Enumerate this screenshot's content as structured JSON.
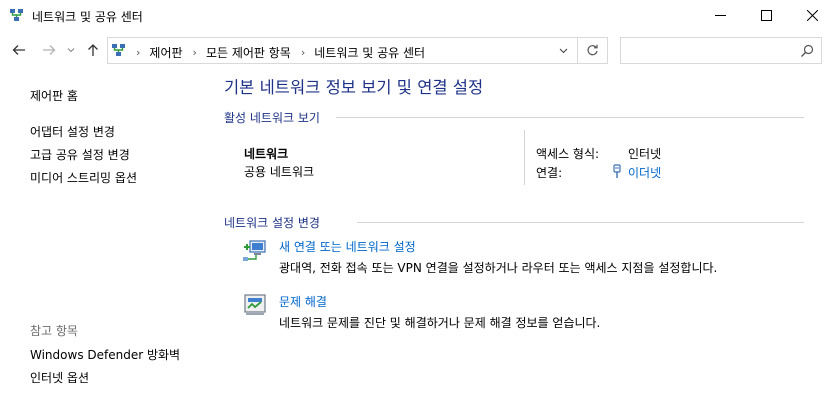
{
  "window": {
    "title": "네트워크 및 공유 센터"
  },
  "address": {
    "breadcrumbs": [
      "제어판",
      "모든 제어판 항목",
      "네트워크 및 공유 센터"
    ],
    "search_placeholder": ""
  },
  "left_pane": {
    "control_panel_home": "제어판 홈",
    "links": [
      "어댑터 설정 변경",
      "고급 공유 설정 변경",
      "미디어 스트리밍 옵션"
    ],
    "see_also_heading": "참고 항목",
    "see_also": [
      "Windows Defender 방화벽",
      "인터넷 옵션"
    ]
  },
  "main": {
    "title": "기본 네트워크 정보 보기 및 연결 설정",
    "active_networks_heading": "활성 네트워크 보기",
    "network": {
      "name": "네트워크",
      "type": "공용 네트워크",
      "access_type_label": "액세스 형식:",
      "access_type_value": "인터넷",
      "connections_label": "연결:",
      "connections_value": "이더넷"
    },
    "change_settings_heading": "네트워크 설정 변경",
    "tasks": [
      {
        "icon": "new-connection-icon",
        "title": "새 연결 또는 네트워크 설정",
        "description": "광대역, 전화 접속 또는 VPN 연결을 설정하거나 라우터 또는 액세스 지점을 설정합니다."
      },
      {
        "icon": "troubleshoot-icon",
        "title": "문제 해결",
        "description": "네트워크 문제를 진단 및 해결하거나 문제 해결 정보를 얻습니다."
      }
    ]
  },
  "colors": {
    "heading_blue": "#1e3287",
    "link_blue": "#0066cc",
    "see_also_gray": "#6d6d6d",
    "rule_gray": "#d5d5d5"
  }
}
